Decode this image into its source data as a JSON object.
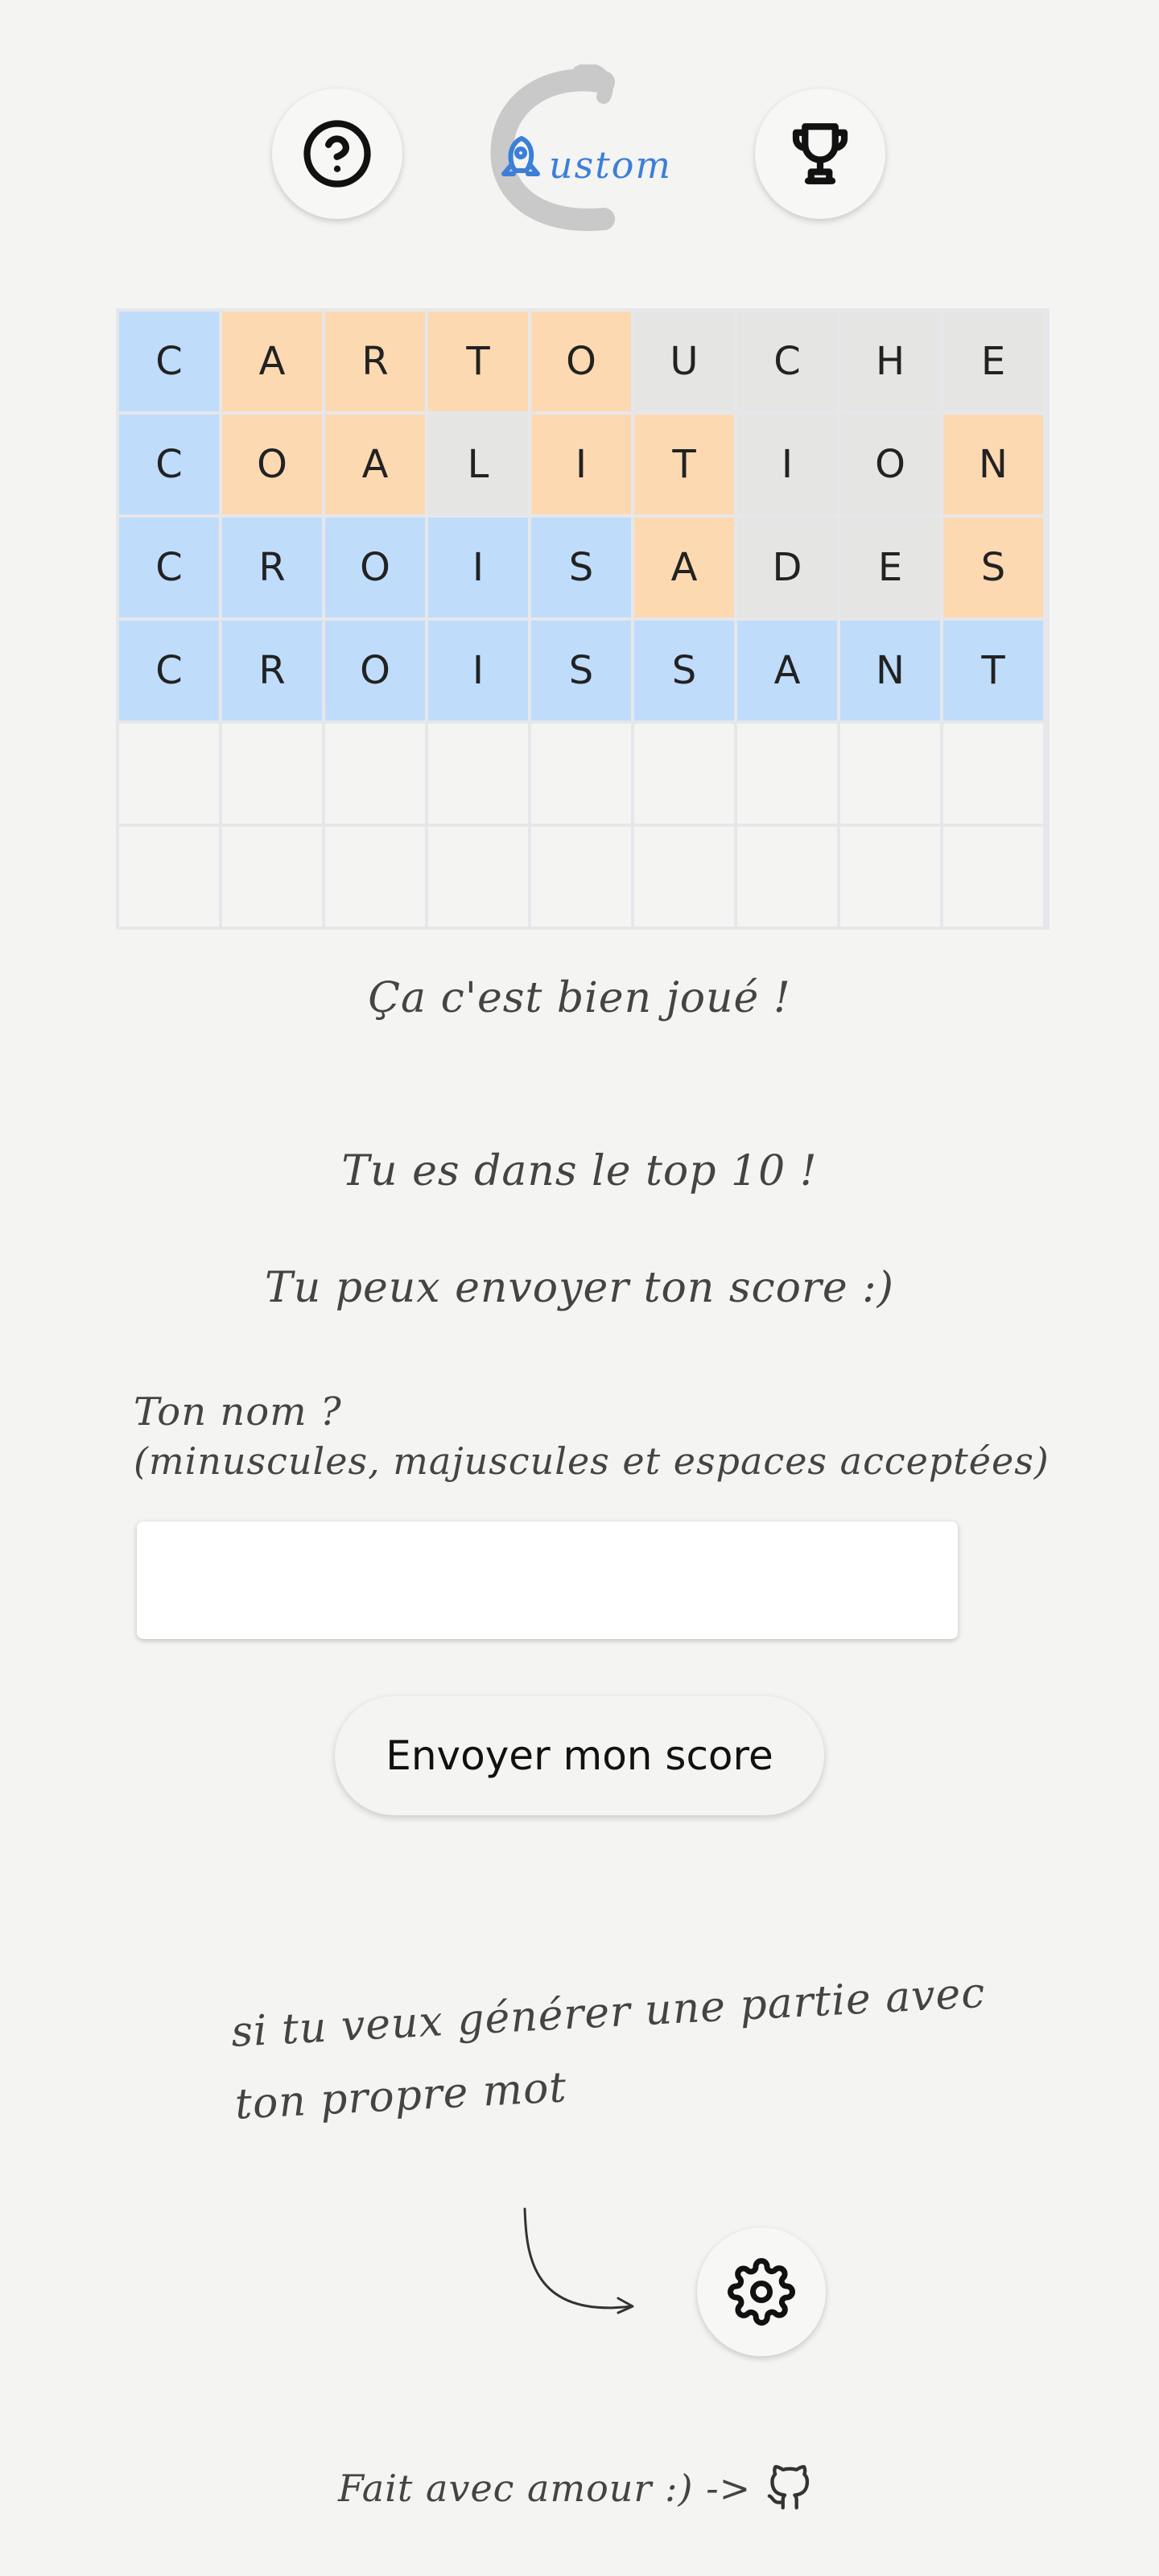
{
  "header": {
    "help_icon": "help-circle-icon",
    "logo_text": "ustom",
    "trophy_icon": "trophy-icon"
  },
  "board": {
    "rows": [
      [
        {
          "l": "C",
          "s": "correct"
        },
        {
          "l": "A",
          "s": "present"
        },
        {
          "l": "R",
          "s": "present"
        },
        {
          "l": "T",
          "s": "present"
        },
        {
          "l": "O",
          "s": "present"
        },
        {
          "l": "U",
          "s": "absent"
        },
        {
          "l": "C",
          "s": "absent"
        },
        {
          "l": "H",
          "s": "absent"
        },
        {
          "l": "E",
          "s": "absent"
        }
      ],
      [
        {
          "l": "C",
          "s": "correct"
        },
        {
          "l": "O",
          "s": "present"
        },
        {
          "l": "A",
          "s": "present"
        },
        {
          "l": "L",
          "s": "absent"
        },
        {
          "l": "I",
          "s": "present"
        },
        {
          "l": "T",
          "s": "present"
        },
        {
          "l": "I",
          "s": "absent"
        },
        {
          "l": "O",
          "s": "absent"
        },
        {
          "l": "N",
          "s": "present"
        }
      ],
      [
        {
          "l": "C",
          "s": "correct"
        },
        {
          "l": "R",
          "s": "correct"
        },
        {
          "l": "O",
          "s": "correct"
        },
        {
          "l": "I",
          "s": "correct"
        },
        {
          "l": "S",
          "s": "correct"
        },
        {
          "l": "A",
          "s": "present"
        },
        {
          "l": "D",
          "s": "absent"
        },
        {
          "l": "E",
          "s": "absent"
        },
        {
          "l": "S",
          "s": "present"
        }
      ],
      [
        {
          "l": "C",
          "s": "correct"
        },
        {
          "l": "R",
          "s": "correct"
        },
        {
          "l": "O",
          "s": "correct"
        },
        {
          "l": "I",
          "s": "correct"
        },
        {
          "l": "S",
          "s": "correct"
        },
        {
          "l": "S",
          "s": "correct"
        },
        {
          "l": "A",
          "s": "correct"
        },
        {
          "l": "N",
          "s": "correct"
        },
        {
          "l": "T",
          "s": "correct"
        }
      ],
      [
        {
          "l": "",
          "s": "empty"
        },
        {
          "l": "",
          "s": "empty"
        },
        {
          "l": "",
          "s": "empty"
        },
        {
          "l": "",
          "s": "empty"
        },
        {
          "l": "",
          "s": "empty"
        },
        {
          "l": "",
          "s": "empty"
        },
        {
          "l": "",
          "s": "empty"
        },
        {
          "l": "",
          "s": "empty"
        },
        {
          "l": "",
          "s": "empty"
        }
      ],
      [
        {
          "l": "",
          "s": "empty"
        },
        {
          "l": "",
          "s": "empty"
        },
        {
          "l": "",
          "s": "empty"
        },
        {
          "l": "",
          "s": "empty"
        },
        {
          "l": "",
          "s": "empty"
        },
        {
          "l": "",
          "s": "empty"
        },
        {
          "l": "",
          "s": "empty"
        },
        {
          "l": "",
          "s": "empty"
        },
        {
          "l": "",
          "s": "empty"
        }
      ]
    ],
    "colors": {
      "correct": "#bfdcfb",
      "present": "#fdd9b2",
      "absent": "#e5e5e4",
      "empty": "#f4f4f2"
    }
  },
  "messages": {
    "win": "Ça c'est bien joué !",
    "top": "Tu es dans le top 10 !",
    "send": "Tu peux envoyer ton score :)"
  },
  "form": {
    "name_label": "Ton nom ?",
    "name_hint": "(minuscules, majuscules et espaces acceptées)",
    "name_value": "",
    "submit_label": "Envoyer mon score"
  },
  "custom": {
    "hint_line1": "si tu veux générer une partie avec",
    "hint_line2": "ton propre mot",
    "settings_icon": "gear-icon"
  },
  "footer": {
    "text": "Fait avec amour :) ->",
    "github_icon": "github-icon"
  }
}
